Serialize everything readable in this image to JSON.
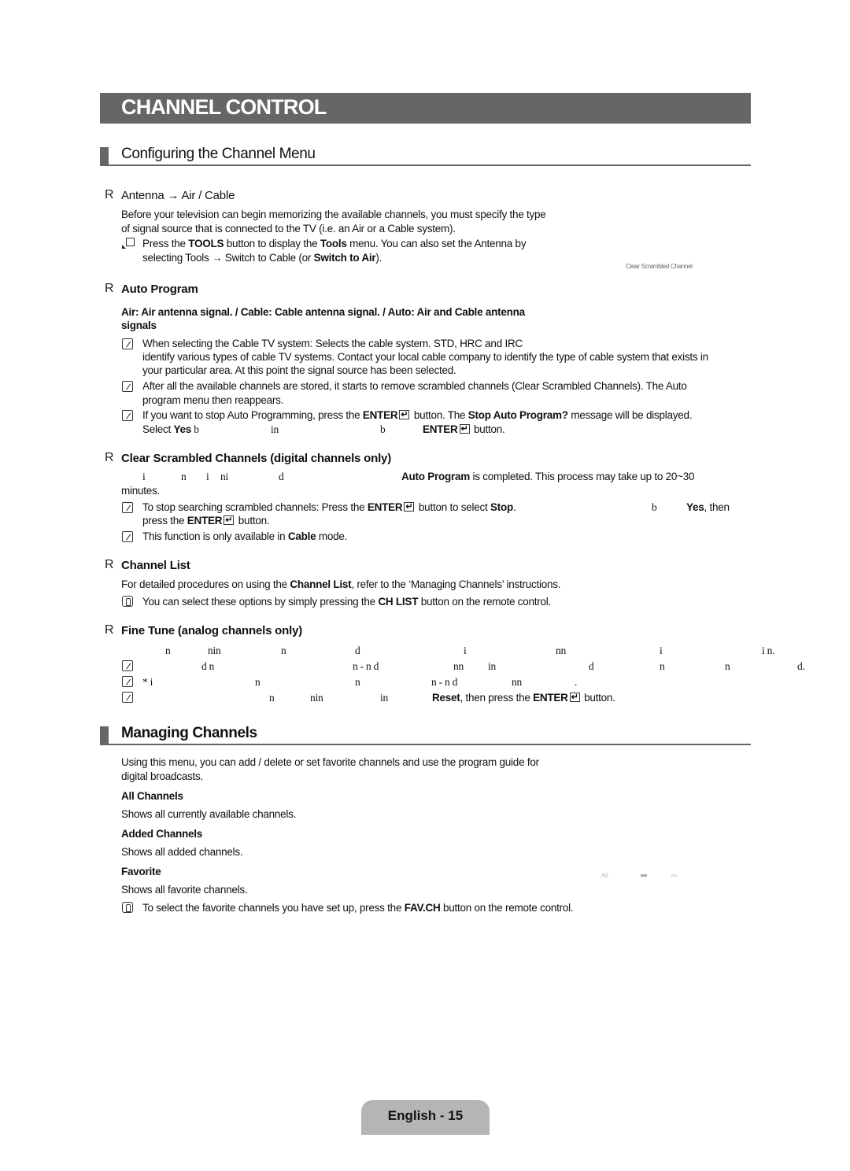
{
  "page": {
    "chapter_title": "CHANNEL CONTROL",
    "footer_label": "English - 15"
  },
  "sections": [
    {
      "title": "Configuring the Channel Menu",
      "items": [
        {
          "bullet": "R",
          "heading_plain": "Antenna → Air / Cable",
          "body": [
            "Before your television can begin memorizing the available channels, you must specify the type",
            "of signal source that is connected to the TV (i.e. an Air or a Cable system)."
          ],
          "tools_note": {
            "icon": "tools-icon",
            "line1_a": "Press the ",
            "line1_b": "TOOLS",
            "line1_c": " button to display the ",
            "line1_d": "Tools",
            "line1_e": " menu. You can also set the Antenna by",
            "line2_a": "selecting Tools → Switch to Cable    (or ",
            "line2_b": "Switch to Air",
            "line2_c": ")."
          },
          "side_label": "Clear Scrambled Channel"
        },
        {
          "bullet": "R",
          "heading": "Auto Program",
          "options_line1": "Air: Air antenna signal. / Cable: Cable antenna signal. / Auto: Air and Cable antenna",
          "options_line2": "signals",
          "notes": [
            {
              "icon": "note-icon",
              "line1": "When selecting the Cable TV system: Selects the cable system. STD, HRC and IRC",
              "line2": "identify various types of cable TV systems. Contact your local cable company to identify the type of cable system that exists in",
              "line3": "your particular area. At this point the signal source has been selected."
            },
            {
              "icon": "note-icon",
              "line1": "After all the available channels are stored, it starts to remove scrambled channels (Clear Scrambled Channels). The Auto",
              "line2": "program menu then reappears."
            },
            {
              "icon": "note-icon",
              "line1_a": "If you want to stop Auto Programming, press the ",
              "line1_b": "ENTER",
              "line1_c": " button. The ",
              "line1_d": "Stop Auto Program?",
              "line1_e": " message will be displayed.",
              "line2_a": "Select ",
              "line2_b": "Yes",
              "line2_c": " b",
              "line2_d": "in",
              "line2_e": "b",
              "line2_f": "ENTER",
              "line2_g": " button."
            }
          ]
        },
        {
          "bullet": "R",
          "heading": "Clear Scrambled Channels (digital channels only)",
          "body_fragments": [
            "i",
            "n",
            "i",
            "ni",
            "d"
          ],
          "body_a": "Auto Program",
          "body_b": " is completed. This process may take up to 20~30",
          "body_line2": "minutes.",
          "notes": [
            {
              "icon": "note-icon",
              "line1_a": "To stop searching scrambled channels: Press the ",
              "line1_b": "ENTER",
              "line1_c": " button to select ",
              "line1_d": "Stop",
              "line1_e": ".",
              "line1_f": "b",
              "line1_g": "Yes",
              "line1_h": ", then",
              "line2_a": "press the ",
              "line2_b": "ENTER",
              "line2_c": " button."
            },
            {
              "icon": "note-icon",
              "line1_a": "This function is only available in ",
              "line1_b": "Cable",
              "line1_c": " mode."
            }
          ]
        },
        {
          "bullet": "R",
          "heading": "Channel List",
          "body_a": "For detailed procedures on using the ",
          "body_b": "Channel List",
          "body_c": ", refer to the ‘Managing Channels’ instructions.",
          "notes": [
            {
              "icon": "remote-icon",
              "line1_a": "You can select these options by simply pressing the ",
              "line1_b": "CH LIST",
              "line1_c": " button on the remote control."
            }
          ]
        },
        {
          "bullet": "R",
          "heading": "Fine Tune (analog channels only)",
          "body_fragments": [
            "n",
            "nin",
            "n",
            "d",
            "i",
            "nn",
            "i",
            "i  n."
          ],
          "notes": [
            {
              "icon": "note-icon",
              "fragments": [
                "d  n",
                "n  -    n  d",
                "nn",
                "in",
                "d",
                "n",
                "n",
                "d."
              ]
            },
            {
              "icon": "note-icon",
              "fragments": [
                "*    i",
                "n",
                "n",
                "n  -    n  d",
                "nn",
                "."
              ]
            },
            {
              "icon": "note-icon",
              "fragments": [
                "n",
                "nin",
                "in"
              ],
              "tail_a": "Reset",
              "tail_b": ", then press the ",
              "tail_c": "ENTER",
              "tail_d": " button."
            }
          ]
        }
      ]
    },
    {
      "title": "Managing Channels",
      "intro_line1": "Using this menu, you can add / delete or set favorite channels and use the program guide for",
      "intro_line2": "digital broadcasts.",
      "entries": [
        {
          "label": "All Channels",
          "desc": "Shows all currently available channels."
        },
        {
          "label": "Added Channels",
          "desc": "Shows all added channels."
        },
        {
          "label": "Favorite",
          "desc": "Shows all favorite channels."
        }
      ],
      "note": {
        "icon": "remote-icon",
        "line1_a": "To select the favorite channels you have set up, press the ",
        "line1_b": "FAV.CH",
        "line1_c": " button on the remote control."
      },
      "side_label": "Air"
    }
  ]
}
